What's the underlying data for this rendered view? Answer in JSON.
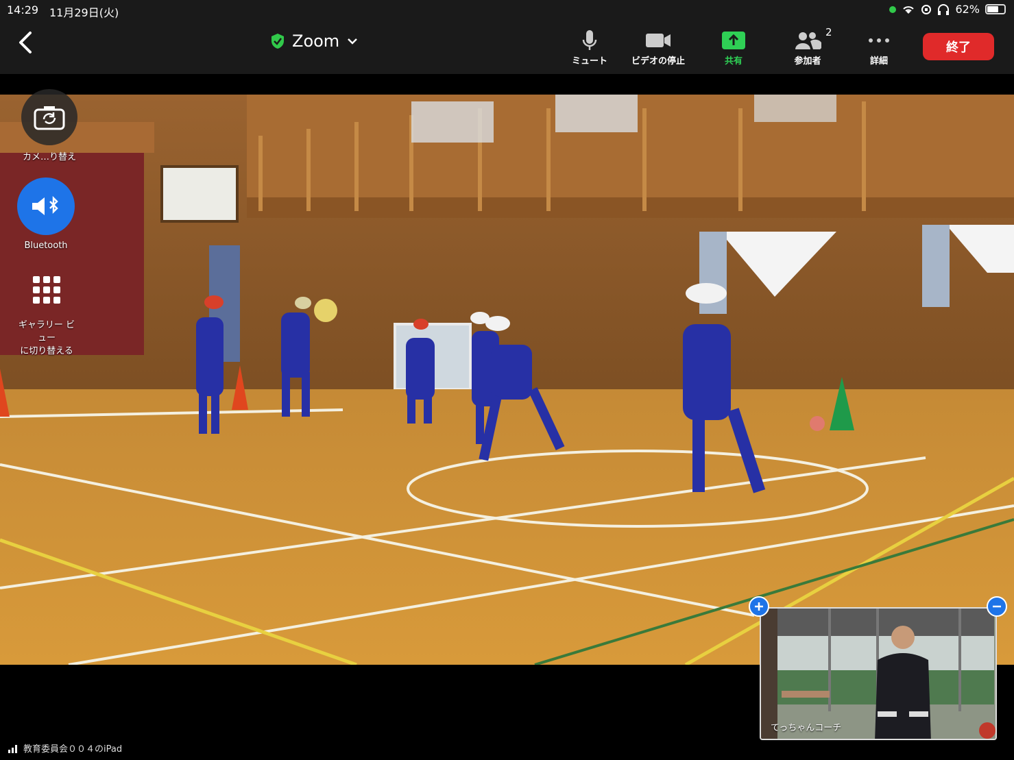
{
  "status_bar": {
    "time": "14:29",
    "date": "11月29日(火)",
    "battery": "62%"
  },
  "toolbar": {
    "title": "Zoom",
    "mute_label": "ミュート",
    "video_stop_label": "ビデオの停止",
    "share_label": "共有",
    "participants_label": "参加者",
    "participants_count": "2",
    "more_label": "詳細",
    "end_label": "終了"
  },
  "side": {
    "camera_switch_label": "カメ…り替え",
    "bluetooth_label": "Bluetooth",
    "gallery_label_line1": "ギャラリー ビ",
    "gallery_label_line2": "ュー",
    "gallery_label_line3": "に切り替える"
  },
  "self_view": {
    "name": "てっちゃんコーチ"
  },
  "device": {
    "name": "教育委員会００４のiPad"
  },
  "colors": {
    "end_button": "#e02a2a",
    "share_green": "#2fd055",
    "accent_blue": "#1e74e8",
    "shield_green": "#31c94a"
  }
}
